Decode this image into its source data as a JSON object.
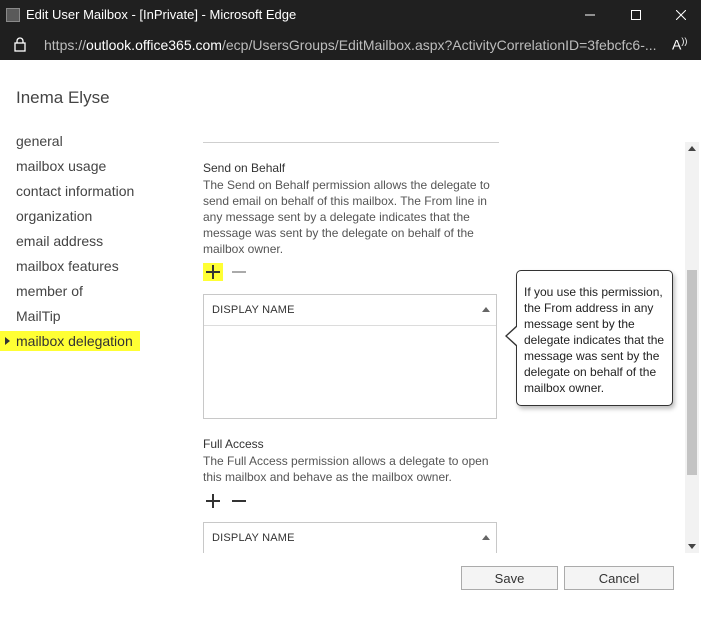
{
  "window": {
    "title": "Edit User Mailbox - [InPrivate] - Microsoft Edge",
    "url_scheme": "https://",
    "url_host": "outlook.office365.com",
    "url_path": "/ecp/UsersGroups/EditMailbox.aspx?ActivityCorrelationID=3febcfc6-..."
  },
  "user": {
    "name": "Inema Elyse"
  },
  "nav": {
    "items": [
      {
        "label": "general"
      },
      {
        "label": "mailbox usage"
      },
      {
        "label": "contact information"
      },
      {
        "label": "organization"
      },
      {
        "label": "email address"
      },
      {
        "label": "mailbox features"
      },
      {
        "label": "member of"
      },
      {
        "label": "MailTip"
      },
      {
        "label": "mailbox delegation"
      }
    ],
    "selected_index": 8,
    "highlight_color": "#ffff34"
  },
  "send_on_behalf": {
    "title": "Send on Behalf",
    "description": "The Send on Behalf permission allows the delegate to send email on behalf of this mailbox. The From line in any message sent by a delegate indicates that the message was sent by the delegate on behalf of the mailbox owner.",
    "column_header": "DISPLAY NAME"
  },
  "full_access": {
    "title": "Full Access",
    "description": "The Full Access permission allows a delegate to open this mailbox and behave as the mailbox owner.",
    "column_header": "DISPLAY NAME"
  },
  "tooltip": {
    "text": "If you use this permission, the From address in any message sent by the delegate indicates that the message was sent by the delegate on behalf of the mailbox owner."
  },
  "buttons": {
    "save": "Save",
    "cancel": "Cancel"
  },
  "icons": {
    "add": "plus-icon",
    "remove": "minus-icon",
    "lock": "lock-icon",
    "read_aloud": "read-aloud-icon"
  }
}
